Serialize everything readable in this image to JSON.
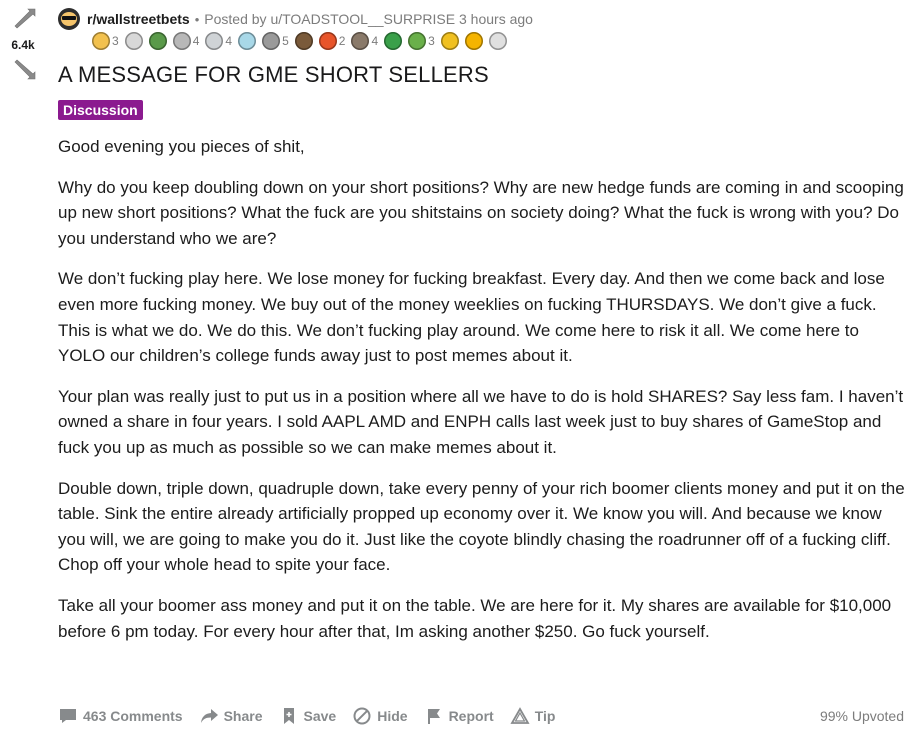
{
  "vote": {
    "score": "6.4k"
  },
  "header": {
    "subreddit": "r/wallstreetbets",
    "separator": "•",
    "posted_by_prefix": "Posted by",
    "username": "u/TOADSTOOL__SURPRISE",
    "time": "3 hours ago"
  },
  "awards": [
    {
      "icon": "gold-face-award-icon",
      "color": "#f2c14e",
      "count": "3"
    },
    {
      "icon": "bird-award-icon",
      "color": "#d8d8d8",
      "count": ""
    },
    {
      "icon": "rocket-dog-award-icon",
      "color": "#5a9a4a",
      "count": ""
    },
    {
      "icon": "silver-hands-award-icon",
      "color": "#b8b8b8",
      "count": "4"
    },
    {
      "icon": "silver-face-award-icon",
      "color": "#cfd3d6",
      "count": "4"
    },
    {
      "icon": "angel-award-icon",
      "color": "#a8d8e8",
      "count": ""
    },
    {
      "icon": "silver-s-award-icon",
      "color": "#9a9a9a",
      "count": "5"
    },
    {
      "icon": "mask-face-award-icon",
      "color": "#7a5a3a",
      "count": ""
    },
    {
      "icon": "fire-award-icon",
      "color": "#e8542a",
      "count": "2"
    },
    {
      "icon": "robot-award-icon",
      "color": "#8a7a6a",
      "count": "4"
    },
    {
      "icon": "dinosaur-award-icon",
      "color": "#3aa04a",
      "count": ""
    },
    {
      "icon": "green-face-award-icon",
      "color": "#6ab04a",
      "count": "3"
    },
    {
      "icon": "sun-face-award-icon",
      "color": "#f0c020",
      "count": ""
    },
    {
      "icon": "hat-award-icon",
      "color": "#f5b400",
      "count": ""
    },
    {
      "icon": "dog-award-icon",
      "color": "#e0e0e0",
      "count": ""
    }
  ],
  "post": {
    "title": "A MESSAGE FOR GME SHORT SELLERS",
    "flair": "Discussion",
    "flair_color": "#8b1a8f",
    "paragraphs": [
      "Good evening you pieces of shit,",
      "Why do you keep doubling down on your short positions? Why are new hedge funds are coming in and scooping up new short positions? What the fuck are you shitstains on society doing? What the fuck is wrong with you? Do you understand who we are?",
      "We don’t fucking play here. We lose money for fucking breakfast. Every day. And then we come back and lose even more fucking money. We buy out of the money weeklies on fucking THURSDAYS. We don’t give a fuck. This is what we do. We do this. We don’t fucking play around. We come here to risk it all. We come here to YOLO our children’s college funds away just to post memes about it.",
      "Your plan was really just to put us in a position where all we have to do is hold SHARES? Say less fam. I haven’t owned a share in four years. I sold AAPL AMD and ENPH calls last week just to buy shares of GameStop and fuck you up as much as possible so we can make memes about it.",
      "Double down, triple down, quadruple down, take every penny of your rich boomer clients money and put it on the table. Sink the entire already artificially propped up economy over it. We know you will. And because we know you will, we are going to make you do it. Just like the coyote blindly chasing the roadrunner off of a fucking cliff. Chop off your whole head to spite your face.",
      "Take all your boomer ass money and put it on the table. We are here for it. My shares are available for $10,000 before 6 pm today. For every hour after that, Im asking another $250. Go fuck yourself."
    ]
  },
  "actions": {
    "comments": "463 Comments",
    "share": "Share",
    "save": "Save",
    "hide": "Hide",
    "report": "Report",
    "tip": "Tip",
    "upvoted": "99% Upvoted"
  }
}
